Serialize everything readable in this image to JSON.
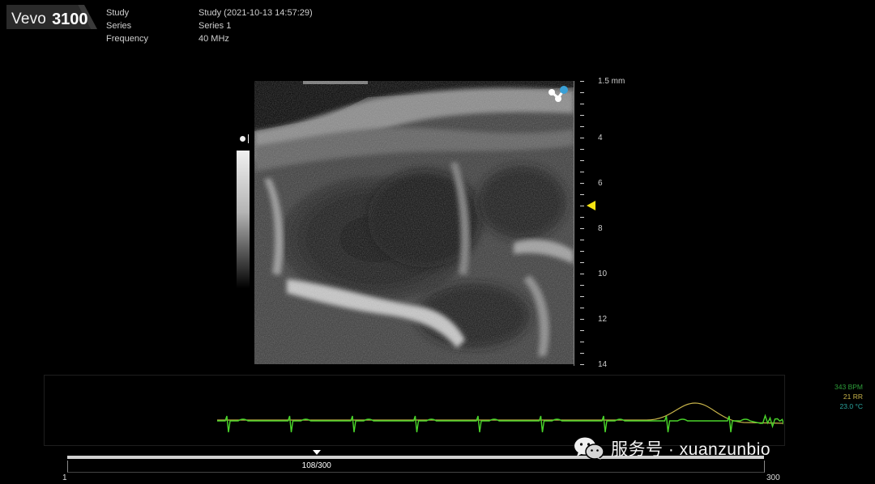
{
  "header": {
    "brand_name": "Vevo",
    "brand_model": "3100",
    "meta": [
      {
        "key": "Study",
        "value": "Study (2021-10-13 14:57:29)"
      },
      {
        "key": "Series",
        "value": "Series 1"
      },
      {
        "key": "Frequency",
        "value": "40 MHz"
      }
    ]
  },
  "depth_scale": {
    "unit_label": "1.5 mm",
    "labels": [
      "4",
      "6",
      "8",
      "10",
      "12",
      "14"
    ],
    "focus_color": "#f6e312"
  },
  "physiology": {
    "heart_rate": "343 BPM",
    "resp_rate": "21 RR",
    "temperature": "23.0 °C",
    "ecg_color": "#4ad62a",
    "resp_color": "#c8b44a",
    "hr_color": "#2e9e3a",
    "temp_color": "#2aa6a0"
  },
  "timeline": {
    "current_frame": 108,
    "total_frames": 300,
    "frame_label": "108/300",
    "min_label": "1",
    "max_label": "300"
  },
  "watermark": {
    "text": "服务号 · xuanzunbio",
    "icon": "wechat-icon"
  }
}
